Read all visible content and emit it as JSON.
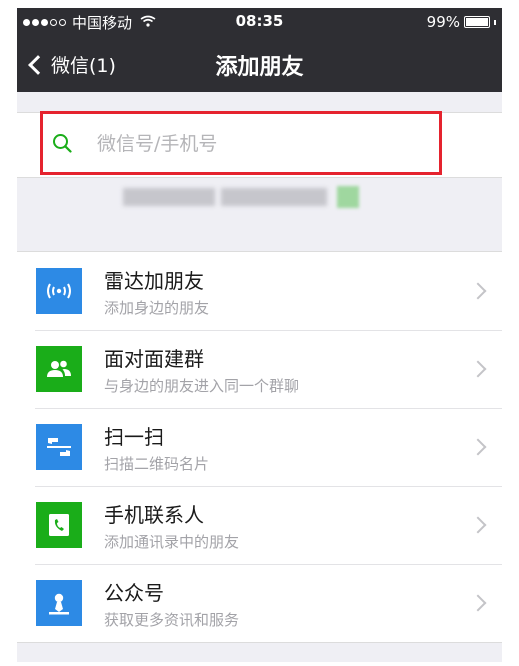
{
  "status_bar": {
    "carrier": "中国移动",
    "time": "08:35",
    "battery": "99%",
    "battery_level": 0.99,
    "signal_dots_filled": 3,
    "signal_dots_total": 5
  },
  "nav": {
    "back_label": "微信(1)",
    "title": "添加朋友"
  },
  "search": {
    "placeholder": "微信号/手机号",
    "value": ""
  },
  "list": {
    "items": [
      {
        "title": "雷达加朋友",
        "subtitle": "添加身边的朋友",
        "icon": "radar-icon",
        "color": "#2d8ae5"
      },
      {
        "title": "面对面建群",
        "subtitle": "与身边的朋友进入同一个群聊",
        "icon": "group-icon",
        "color": "#1aad19"
      },
      {
        "title": "扫一扫",
        "subtitle": "扫描二维码名片",
        "icon": "scan-icon",
        "color": "#2d8ae5"
      },
      {
        "title": "手机联系人",
        "subtitle": "添加通讯录中的朋友",
        "icon": "phone-contacts-icon",
        "color": "#1aad19"
      },
      {
        "title": "公众号",
        "subtitle": "获取更多资讯和服务",
        "icon": "official-account-icon",
        "color": "#2d8ae5"
      }
    ]
  },
  "colors": {
    "header_bg": "#2e2e33",
    "page_bg": "#efeff4",
    "highlight": "#e5232e",
    "search_icon": "#1aad19"
  }
}
